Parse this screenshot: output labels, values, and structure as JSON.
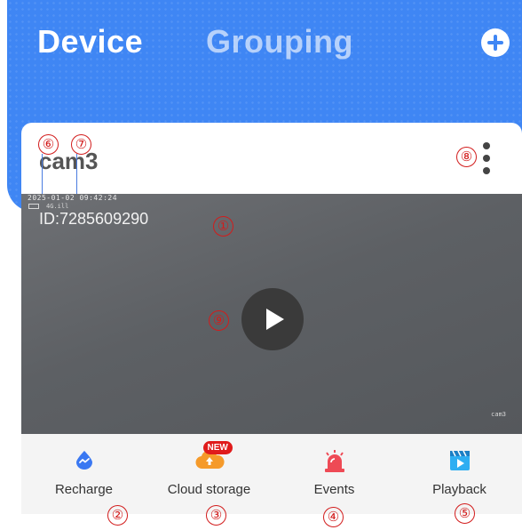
{
  "header": {
    "tab_device": "Device",
    "tab_grouping": "Grouping",
    "add_icon": "plus-circle-icon",
    "colors": {
      "header_bg": "#3f86f4"
    }
  },
  "card": {
    "device_name": "cam3",
    "more_icon": "more-vertical-icon",
    "video": {
      "timestamp": "2025-01-02 09:42:24",
      "status_signal": "4G.ill",
      "device_id": "ID:7285609290",
      "watermark": "cam3",
      "play_icon": "play-icon"
    }
  },
  "actions": [
    {
      "id": "recharge",
      "label": "Recharge",
      "icon": "recharge-icon",
      "color": "#3a78f2"
    },
    {
      "id": "cloud",
      "label": "Cloud storage",
      "icon": "cloud-upload-icon",
      "color": "#f59a2a",
      "badge": "NEW"
    },
    {
      "id": "events",
      "label": "Events",
      "icon": "alarm-siren-icon",
      "color": "#ee4a55"
    },
    {
      "id": "playback",
      "label": "Playback",
      "icon": "playback-icon",
      "color": "#2eaef2"
    }
  ],
  "annotations": {
    "m1": "①",
    "m2": "②",
    "m3": "③",
    "m4": "④",
    "m5": "⑤",
    "m6": "⑥",
    "m7": "⑦",
    "m8": "⑧",
    "m9": "⑨"
  }
}
